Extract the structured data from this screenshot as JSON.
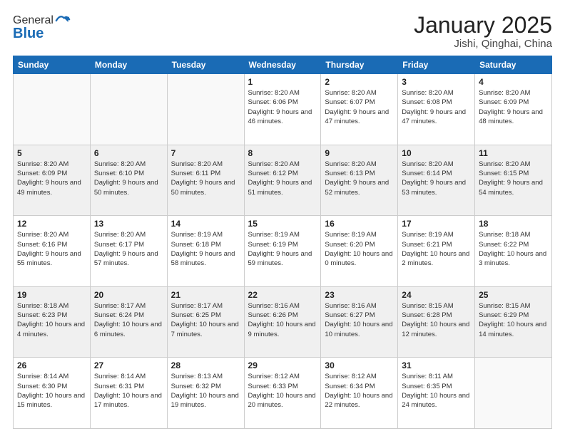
{
  "logo": {
    "general": "General",
    "blue": "Blue"
  },
  "title": "January 2025",
  "subtitle": "Jishi, Qinghai, China",
  "days_of_week": [
    "Sunday",
    "Monday",
    "Tuesday",
    "Wednesday",
    "Thursday",
    "Friday",
    "Saturday"
  ],
  "weeks": [
    [
      {
        "day": "",
        "info": ""
      },
      {
        "day": "",
        "info": ""
      },
      {
        "day": "",
        "info": ""
      },
      {
        "day": "1",
        "info": "Sunrise: 8:20 AM\nSunset: 6:06 PM\nDaylight: 9 hours\nand 46 minutes."
      },
      {
        "day": "2",
        "info": "Sunrise: 8:20 AM\nSunset: 6:07 PM\nDaylight: 9 hours\nand 47 minutes."
      },
      {
        "day": "3",
        "info": "Sunrise: 8:20 AM\nSunset: 6:08 PM\nDaylight: 9 hours\nand 47 minutes."
      },
      {
        "day": "4",
        "info": "Sunrise: 8:20 AM\nSunset: 6:09 PM\nDaylight: 9 hours\nand 48 minutes."
      }
    ],
    [
      {
        "day": "5",
        "info": "Sunrise: 8:20 AM\nSunset: 6:09 PM\nDaylight: 9 hours\nand 49 minutes."
      },
      {
        "day": "6",
        "info": "Sunrise: 8:20 AM\nSunset: 6:10 PM\nDaylight: 9 hours\nand 50 minutes."
      },
      {
        "day": "7",
        "info": "Sunrise: 8:20 AM\nSunset: 6:11 PM\nDaylight: 9 hours\nand 50 minutes."
      },
      {
        "day": "8",
        "info": "Sunrise: 8:20 AM\nSunset: 6:12 PM\nDaylight: 9 hours\nand 51 minutes."
      },
      {
        "day": "9",
        "info": "Sunrise: 8:20 AM\nSunset: 6:13 PM\nDaylight: 9 hours\nand 52 minutes."
      },
      {
        "day": "10",
        "info": "Sunrise: 8:20 AM\nSunset: 6:14 PM\nDaylight: 9 hours\nand 53 minutes."
      },
      {
        "day": "11",
        "info": "Sunrise: 8:20 AM\nSunset: 6:15 PM\nDaylight: 9 hours\nand 54 minutes."
      }
    ],
    [
      {
        "day": "12",
        "info": "Sunrise: 8:20 AM\nSunset: 6:16 PM\nDaylight: 9 hours\nand 55 minutes."
      },
      {
        "day": "13",
        "info": "Sunrise: 8:20 AM\nSunset: 6:17 PM\nDaylight: 9 hours\nand 57 minutes."
      },
      {
        "day": "14",
        "info": "Sunrise: 8:19 AM\nSunset: 6:18 PM\nDaylight: 9 hours\nand 58 minutes."
      },
      {
        "day": "15",
        "info": "Sunrise: 8:19 AM\nSunset: 6:19 PM\nDaylight: 9 hours\nand 59 minutes."
      },
      {
        "day": "16",
        "info": "Sunrise: 8:19 AM\nSunset: 6:20 PM\nDaylight: 10 hours\nand 0 minutes."
      },
      {
        "day": "17",
        "info": "Sunrise: 8:19 AM\nSunset: 6:21 PM\nDaylight: 10 hours\nand 2 minutes."
      },
      {
        "day": "18",
        "info": "Sunrise: 8:18 AM\nSunset: 6:22 PM\nDaylight: 10 hours\nand 3 minutes."
      }
    ],
    [
      {
        "day": "19",
        "info": "Sunrise: 8:18 AM\nSunset: 6:23 PM\nDaylight: 10 hours\nand 4 minutes."
      },
      {
        "day": "20",
        "info": "Sunrise: 8:17 AM\nSunset: 6:24 PM\nDaylight: 10 hours\nand 6 minutes."
      },
      {
        "day": "21",
        "info": "Sunrise: 8:17 AM\nSunset: 6:25 PM\nDaylight: 10 hours\nand 7 minutes."
      },
      {
        "day": "22",
        "info": "Sunrise: 8:16 AM\nSunset: 6:26 PM\nDaylight: 10 hours\nand 9 minutes."
      },
      {
        "day": "23",
        "info": "Sunrise: 8:16 AM\nSunset: 6:27 PM\nDaylight: 10 hours\nand 10 minutes."
      },
      {
        "day": "24",
        "info": "Sunrise: 8:15 AM\nSunset: 6:28 PM\nDaylight: 10 hours\nand 12 minutes."
      },
      {
        "day": "25",
        "info": "Sunrise: 8:15 AM\nSunset: 6:29 PM\nDaylight: 10 hours\nand 14 minutes."
      }
    ],
    [
      {
        "day": "26",
        "info": "Sunrise: 8:14 AM\nSunset: 6:30 PM\nDaylight: 10 hours\nand 15 minutes."
      },
      {
        "day": "27",
        "info": "Sunrise: 8:14 AM\nSunset: 6:31 PM\nDaylight: 10 hours\nand 17 minutes."
      },
      {
        "day": "28",
        "info": "Sunrise: 8:13 AM\nSunset: 6:32 PM\nDaylight: 10 hours\nand 19 minutes."
      },
      {
        "day": "29",
        "info": "Sunrise: 8:12 AM\nSunset: 6:33 PM\nDaylight: 10 hours\nand 20 minutes."
      },
      {
        "day": "30",
        "info": "Sunrise: 8:12 AM\nSunset: 6:34 PM\nDaylight: 10 hours\nand 22 minutes."
      },
      {
        "day": "31",
        "info": "Sunrise: 8:11 AM\nSunset: 6:35 PM\nDaylight: 10 hours\nand 24 minutes."
      },
      {
        "day": "",
        "info": ""
      }
    ]
  ]
}
